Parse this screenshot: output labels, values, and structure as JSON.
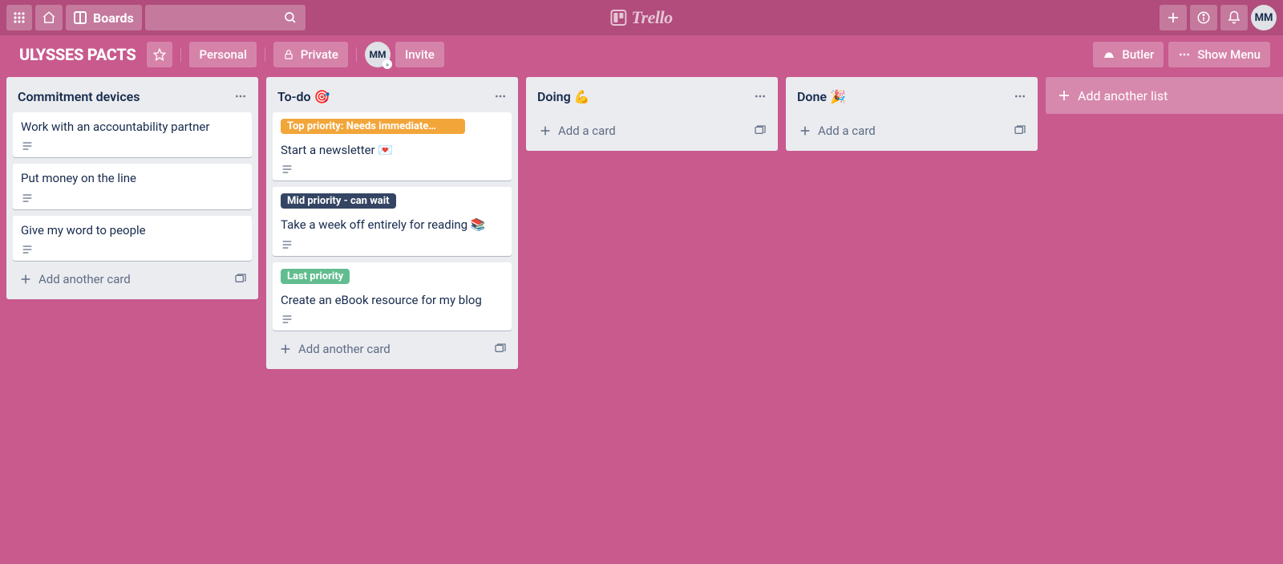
{
  "topbar": {
    "boards_label": "Boards",
    "logo_text": "Trello",
    "avatar_initials": "MM"
  },
  "board_header": {
    "board_name": "ULYSSES PACTS",
    "personal_label": "Personal",
    "private_label": "Private",
    "member_initials": "MM",
    "invite_label": "Invite",
    "butler_label": "Butler",
    "show_menu_label": "Show Menu"
  },
  "lists": [
    {
      "title": "Commitment devices",
      "cards": [
        {
          "title": "Work with an accountability partner",
          "has_description": true
        },
        {
          "title": "Put money on the line",
          "has_description": true
        },
        {
          "title": "Give my word to people",
          "has_description": true
        }
      ],
      "add_card_label": "Add another card"
    },
    {
      "title": "To-do 🎯",
      "cards": [
        {
          "label_text": "Top priority: Needs immediate…",
          "label_color": "orange",
          "title": "Start a newsletter 💌",
          "has_description": true
        },
        {
          "label_text": "Mid priority - can wait",
          "label_color": "navy",
          "title": "Take a week off entirely for reading 📚",
          "has_description": true
        },
        {
          "label_text": "Last priority",
          "label_color": "green",
          "title": "Create an eBook resource for my blog",
          "has_description": true
        }
      ],
      "add_card_label": "Add another card"
    },
    {
      "title": "Doing 💪",
      "cards": [],
      "add_card_label": "Add a card"
    },
    {
      "title": "Done 🎉",
      "cards": [],
      "add_card_label": "Add a card"
    }
  ],
  "add_list_label": "Add another list"
}
